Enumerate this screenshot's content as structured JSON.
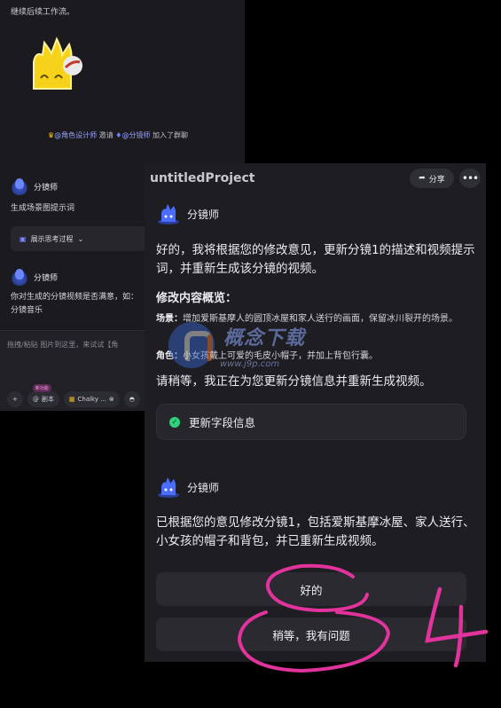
{
  "background_chat": {
    "top_text": "继续后续工作流。",
    "join_notice": {
      "inviter": "@角色设计师",
      "action": "邀请",
      "invitee": "@分镜师",
      "suffix": "加入了群聊"
    },
    "agent_name": "分镜师",
    "message_1": "生成场景图提示词",
    "think_button": "展示思考过程",
    "agent_name_2": "分镜师",
    "message_2_line1": "你对生成的分镜视频是否满意，如：",
    "message_2_line2": "分镜音乐",
    "input_placeholder": "拖拽/粘贴 图片到这里，来试试【角",
    "tools": {
      "add": "+",
      "script": "剧本",
      "script_badge": "新功能",
      "style": "Chalky ..."
    }
  },
  "main_panel": {
    "project_title": "untitledProject",
    "share_label": "分享",
    "more_label": "•••",
    "agent_name": "分镜师",
    "intro": "好的，我将根据您的修改意见，更新分镜1的描述和视频提示词，并重新生成该分镜的视频。",
    "summary_heading": "修改内容概览：",
    "scene_label": "场景：",
    "scene_text": "增加爱斯基摩人的圆顶冰屋和家人送行的画面，保留冰川裂开的场景。",
    "role_label": "角色：",
    "role_text": "小女孩戴上可爱的毛皮小帽子，并加上背包行囊。",
    "waiting_text": "请稍等，我正在为您更新分镜信息并重新生成视频。",
    "field_update": "更新字段信息",
    "agent_name_2": "分镜师",
    "done_text": "已根据您的意见修改分镜1，包括爱斯基摩冰屋、家人送行、小女孩的帽子和背包，并已重新生成视频。",
    "reply_ok": "好的",
    "reply_question": "稍等，我有问题"
  },
  "annotation_text": "4",
  "watermark": {
    "main": "概念下载",
    "url": "www.j9p.com"
  },
  "colors": {
    "accent_pink": "#e0339b",
    "success_green": "#2fd27b",
    "avatar_blue": "#4a6dff"
  }
}
